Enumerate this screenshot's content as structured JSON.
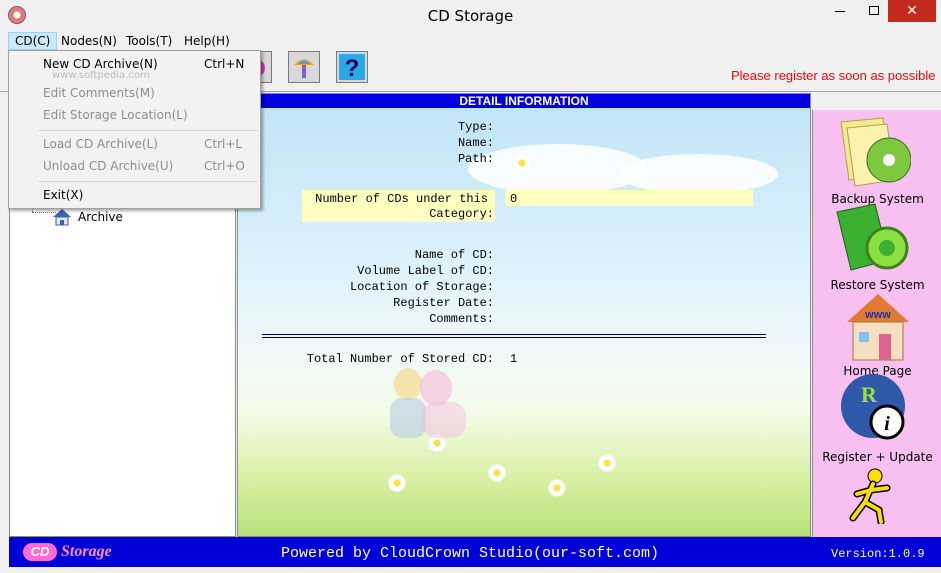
{
  "window": {
    "title": "CD Storage",
    "close_glyph": "✕"
  },
  "menubar": [
    {
      "label": "CD(C)"
    },
    {
      "label": "Nodes(N)"
    },
    {
      "label": "Tools(T)"
    },
    {
      "label": "Help(H)"
    }
  ],
  "dropdown": {
    "items": [
      {
        "label": "New CD Archive(N)",
        "shortcut": "Ctrl+N",
        "enabled": true
      },
      {
        "label": "Edit Comments(M)",
        "shortcut": "",
        "enabled": false
      },
      {
        "label": "Edit Storage Location(L)",
        "shortcut": "",
        "enabled": false
      },
      {
        "label": "Load CD Archive(L)",
        "shortcut": "Ctrl+L",
        "enabled": false
      },
      {
        "label": "Unload CD Archive(U)",
        "shortcut": "Ctrl+O",
        "enabled": false
      },
      {
        "label": "Exit(X)",
        "shortcut": "",
        "enabled": true
      }
    ]
  },
  "toolbar": {
    "register_msg": "Please register as soon as possible",
    "icons": [
      "toolbox-icon",
      "paint-brush-icon",
      "help-icon"
    ]
  },
  "tree": {
    "root_label": "Archive",
    "icon": "home-icon"
  },
  "detail": {
    "header": "DETAIL INFORMATION",
    "type_label": "Type:",
    "name_label": "Name:",
    "path_label": "Path:",
    "num_cds_label_1": "Number of CDs under this",
    "num_cds_label_2": "Category:",
    "num_cds_value": "0",
    "cd_name_label": "Name of CD:",
    "volume_label": "Volume Label of CD:",
    "location_label": "Location of Storage:",
    "register_date_label": "Register Date:",
    "comments_label": "Comments:",
    "total_label": "Total Number of Stored CD:",
    "total_value": "1"
  },
  "sidebar": {
    "backup": "Backup System",
    "restore": "Restore System",
    "home": "Home Page",
    "register": "Register + Update"
  },
  "footer": {
    "logo_cd": "CD",
    "logo_text": "Storage",
    "powered": "Powered by CloudCrown Studio(our-soft.com)",
    "version": "Version:1.0.9"
  },
  "watermark": "www.softpedia.com",
  "colors": {
    "header_blue": "#0000e0",
    "sidebar_pink": "#f7c0f0",
    "register_red": "#ff0000",
    "highlight": "#ffffc0"
  }
}
